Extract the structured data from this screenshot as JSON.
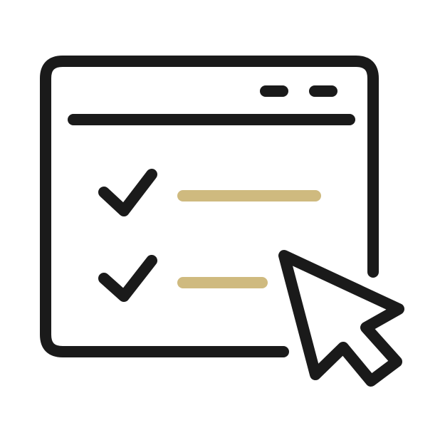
{
  "illustration": {
    "icon": "checklist-browser-window-with-cursor",
    "colors": {
      "background": "#ffffff",
      "stroke": "#1a1a1a",
      "accent": "#cfba7f"
    },
    "window": {
      "icon": "browser-window-icon",
      "controls": [
        "minimize-dash",
        "maximize-dash"
      ]
    },
    "checklist": {
      "items": [
        {
          "icon": "checkmark-icon",
          "checked": true,
          "line_fraction": 1.0
        },
        {
          "icon": "checkmark-icon",
          "checked": true,
          "line_fraction": 0.6
        }
      ]
    },
    "cursor": {
      "icon": "mouse-pointer-icon"
    }
  }
}
